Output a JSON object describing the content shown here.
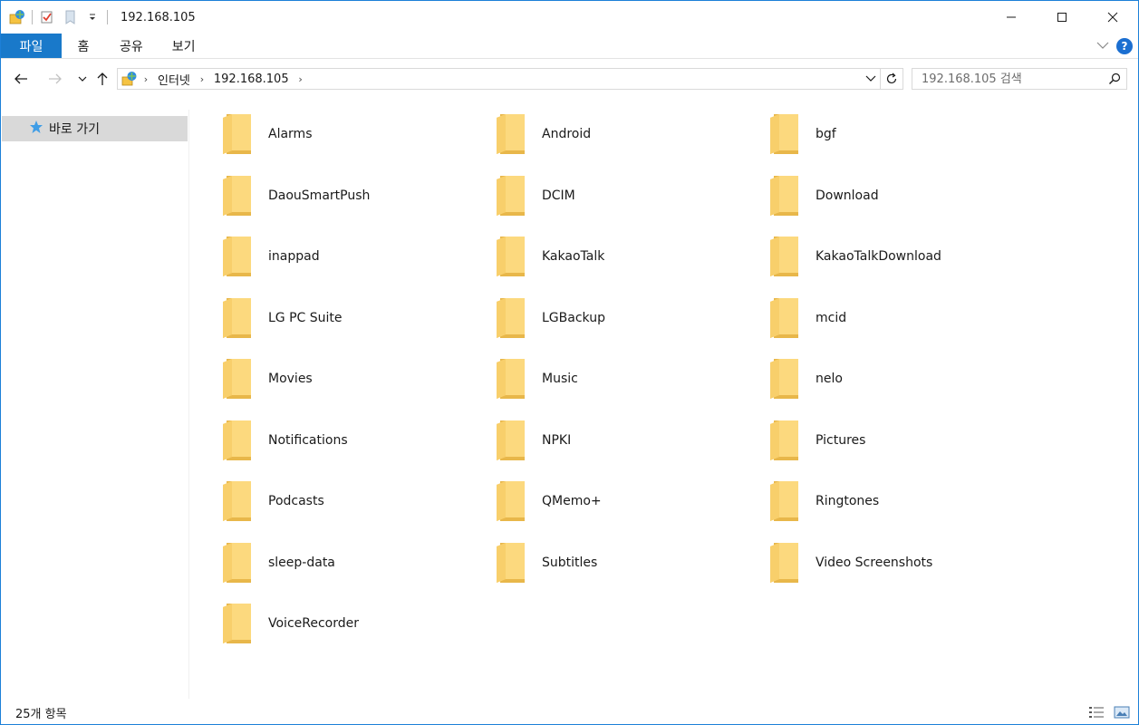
{
  "window": {
    "title": "192.168.105"
  },
  "ribbon": {
    "tabs": [
      "파일",
      "홈",
      "공유",
      "보기"
    ],
    "help_label": "?"
  },
  "address_bar": {
    "root_crumb": "인터넷",
    "crumb": "192.168.105"
  },
  "search": {
    "placeholder": "192.168.105 검색"
  },
  "sidebar": {
    "quick_access": "바로 가기"
  },
  "folders": [
    "Alarms",
    "Android",
    "bgf",
    "DaouSmartPush",
    "DCIM",
    "Download",
    "inappad",
    "KakaoTalk",
    "KakaoTalkDownload",
    "LG PC Suite",
    "LGBackup",
    "mcid",
    "Movies",
    "Music",
    "nelo",
    "Notifications",
    "NPKI",
    "Pictures",
    "Podcasts",
    "QMemo+",
    "Ringtones",
    "sleep-data",
    "Subtitles",
    "Video Screenshots",
    "VoiceRecorder"
  ],
  "status": {
    "item_count": "25개 항목"
  },
  "colors": {
    "accent": "#1979ca",
    "folder_body": "#fcd97e",
    "folder_back": "#e8b74a",
    "selection": "#d9d9d9"
  },
  "icons": {
    "app": "network-drive-icon",
    "folder": "folder-icon",
    "star": "star-icon"
  }
}
